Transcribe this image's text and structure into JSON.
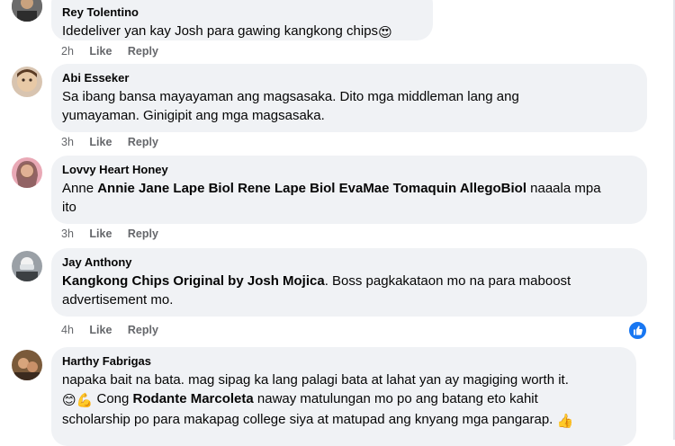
{
  "comments": [
    {
      "author": "Rey Tolentino",
      "text": "Idedeliver yan kay Josh para gawing kangkong chips",
      "emoji": "😍",
      "time": "2h",
      "like": "Like",
      "reply": "Reply"
    },
    {
      "author": "Abi Esseker",
      "line1": "Sa ibang bansa mayayaman ang magsasaka. Dito mga middleman lang ang",
      "line2": "yumayaman. Ginigipit ang mga magsasaka.",
      "time": "3h",
      "like": "Like",
      "reply": "Reply"
    },
    {
      "author": "Lovvy Heart Honey",
      "prefix": "Anne",
      "mention1": "Annie Jane Lape Biol",
      "mention2": "Rene Lape Biol",
      "mention3": "EvaMae Tomaquin AllegoBiol",
      "suffix": "naaala mpa",
      "line2": "ito",
      "time": "3h",
      "like": "Like",
      "reply": "Reply"
    },
    {
      "author": "Jay Anthony",
      "mention": "Kangkong Chips Original by Josh Mojica",
      "rest": ". Boss pagkakataon mo na para maboost",
      "line2": "advertisement mo.",
      "time": "4h",
      "like": "Like",
      "reply": "Reply",
      "reaction_icon": "thumbs-up-icon"
    },
    {
      "author": "Harthy Fabrigas",
      "line1": "napaka bait na bata. mag sipag ka lang palagi bata at lahat yan ay magiging worth it.",
      "emoji_a": "😊",
      "emoji_b": "💪",
      "cong": "Cong",
      "mention": "Rodante Marcoleta",
      "line2_rest": "naway matulungan mo po ang batang eto kahit",
      "line3": "scholarship po para makapag college siya at matupad ang knyang mga pangarap.",
      "emoji_c": "👍"
    }
  ],
  "colors": {
    "bubble": "#f0f2f5",
    "meta": "#65676b",
    "like_blue": "#1877f2"
  }
}
